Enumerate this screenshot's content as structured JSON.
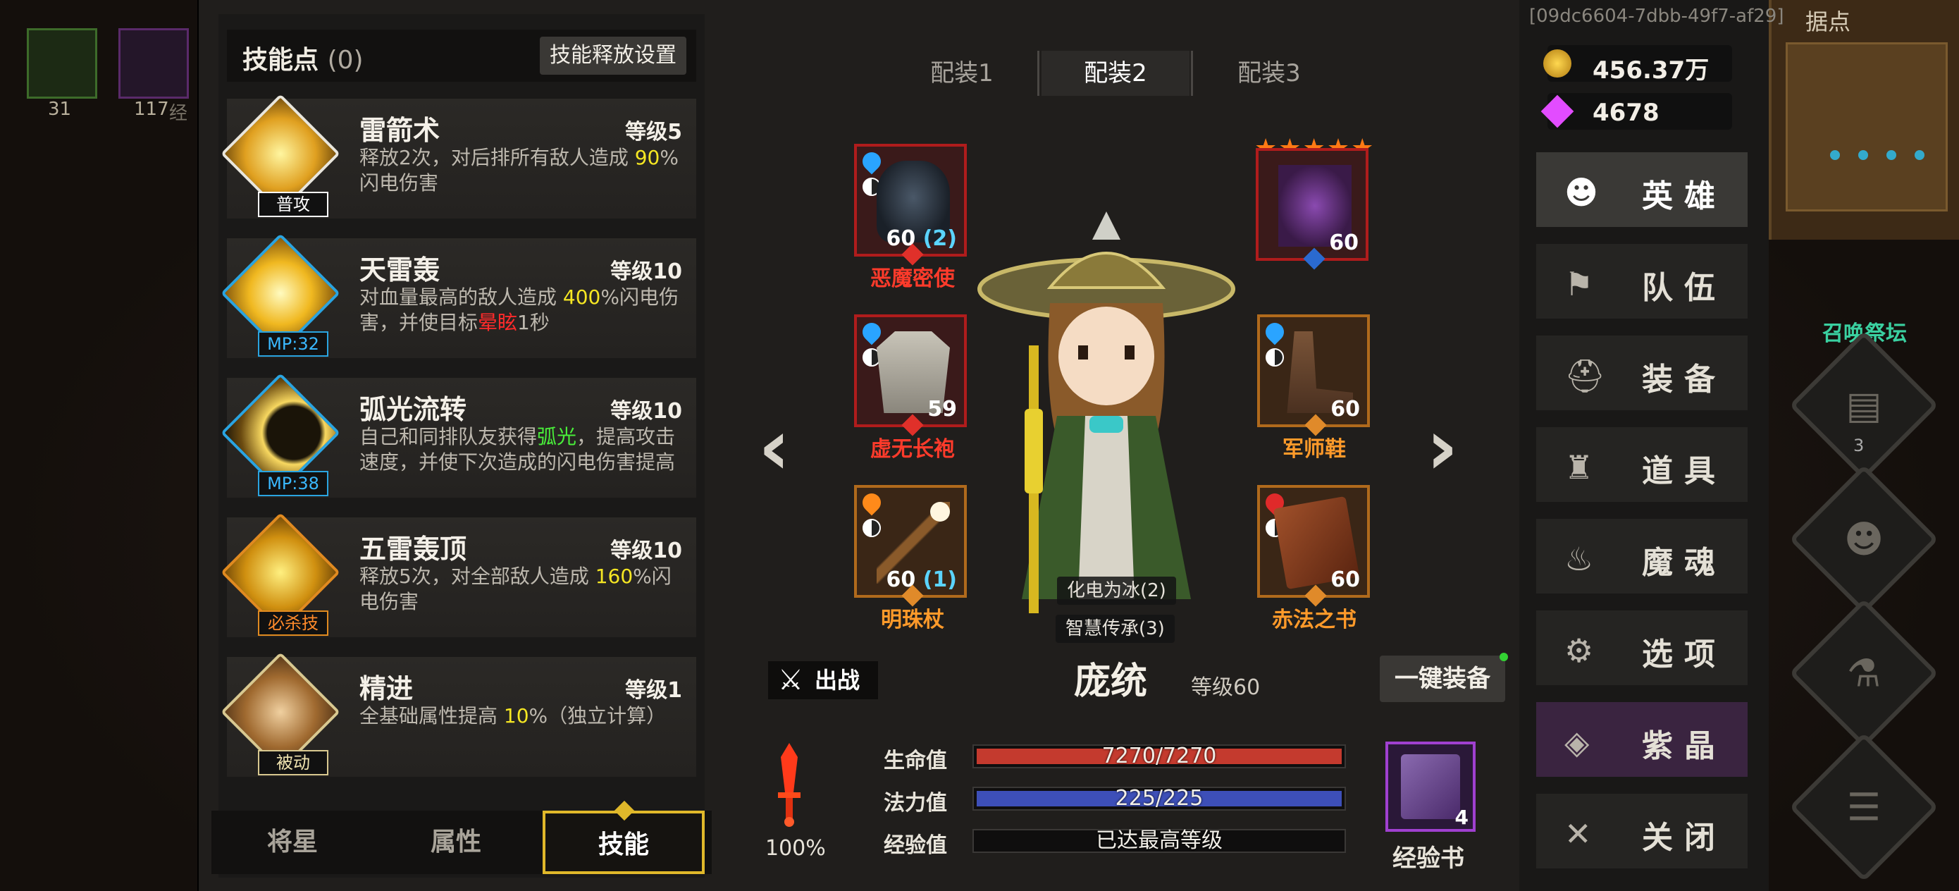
{
  "background": {
    "slot_counts": [
      "31",
      "117"
    ],
    "partial_label_1": "经",
    "map_label": "据点",
    "summon_altar": "召唤祭坛",
    "diamond_badge": "3"
  },
  "skills_panel": {
    "title": "技能点",
    "points": "(0)",
    "release_settings": "技能释放设置",
    "skills": [
      {
        "name": "雷箭术",
        "level": "等级5",
        "tag": "普攻",
        "desc_a": "释放2次，对后排所有敌人造成 ",
        "desc_hl": "90",
        "desc_b": "%闪电伤害",
        "hl2": "",
        "desc_c": ""
      },
      {
        "name": "天雷轰",
        "level": "等级10",
        "tag": "MP:32",
        "desc_a": "对血量最高的敌人造成 ",
        "desc_hl": "400",
        "desc_b": "%闪电伤害，并使目标",
        "hl2": "晕眩",
        "desc_c": "1秒"
      },
      {
        "name": "弧光流转",
        "level": "等级10",
        "tag": "MP:38",
        "desc_a": "自己和同排队友获得",
        "desc_hl": "弧光",
        "desc_b": "，提高攻击速度，并使下次造成的闪电伤害提高",
        "hl2": "",
        "desc_c": ""
      },
      {
        "name": "五雷轰顶",
        "level": "等级10",
        "tag": "必杀技",
        "desc_a": "释放5次，对全部敌人造成 ",
        "desc_hl": "160",
        "desc_b": "%闪电伤害",
        "hl2": "",
        "desc_c": ""
      },
      {
        "name": "精进",
        "level": "等级1",
        "tag": "被动",
        "desc_a": "全基础属性提高 ",
        "desc_hl": "10",
        "desc_b": "%（独立计算）",
        "hl2": "",
        "desc_c": ""
      }
    ],
    "tabs": [
      "将星",
      "属性",
      "技能"
    ],
    "active_tab": "技能"
  },
  "loadout_tabs": [
    "配装1",
    "配装2",
    "配装3"
  ],
  "active_loadout": "配装2",
  "equipment": {
    "left": [
      {
        "name": "恶魔密使",
        "level": "60",
        "bonus": "(2)",
        "gem": "blue-gem"
      },
      {
        "name": "虚无长袍",
        "level": "59",
        "bonus": "",
        "gem": "blue-gem"
      },
      {
        "name": "明珠杖",
        "level": "60",
        "bonus": "(1)",
        "gem": "orange-gem"
      }
    ],
    "right": [
      {
        "name": "",
        "level": "60",
        "bonus": "",
        "stars": "★★★★★"
      },
      {
        "name": "军师鞋",
        "level": "60",
        "bonus": "",
        "gem": "blue-gem"
      },
      {
        "name": "赤法之书",
        "level": "60",
        "bonus": "",
        "gem": "red-gem"
      }
    ]
  },
  "hero": {
    "traits": [
      "化电为冰(2)",
      "智慧传承(3)"
    ],
    "name": "庞统",
    "level": "等级60",
    "deploy": "出战",
    "equip_all": "一键装备"
  },
  "stats": {
    "hp_label": "生命值",
    "hp_value": "7270/7270",
    "hp_fraction": 1.0,
    "mp_label": "法力值",
    "mp_value": "225/225",
    "mp_fraction": 1.0,
    "exp_label": "经验值",
    "exp_value": "已达最高等级",
    "power_percent": "100%",
    "exp_book_label": "经验书",
    "exp_book_count": "4"
  },
  "right_panel": {
    "uid": "[09dc6604-7dbb-49f7-af29]",
    "gold": "456.37万",
    "gems": "4678",
    "menu": [
      "英雄",
      "队伍",
      "装备",
      "道具",
      "魔魂",
      "选项",
      "紫晶",
      "关闭"
    ],
    "active_menu": "英雄"
  },
  "colors": {
    "accent_gold": "#e0b82a",
    "hp_bar": "#c43a2e",
    "mp_bar": "#3d4fb8",
    "highlight_yellow": "#f5e623",
    "highlight_red": "#ff2b2b",
    "highlight_green": "#49ef3a"
  }
}
